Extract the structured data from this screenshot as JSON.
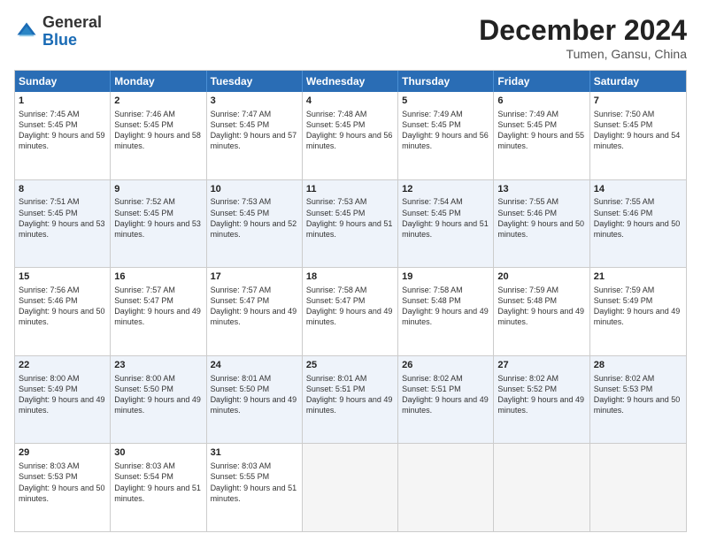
{
  "header": {
    "logo_general": "General",
    "logo_blue": "Blue",
    "month_title": "December 2024",
    "location": "Tumen, Gansu, China"
  },
  "days_of_week": [
    "Sunday",
    "Monday",
    "Tuesday",
    "Wednesday",
    "Thursday",
    "Friday",
    "Saturday"
  ],
  "weeks": [
    [
      {
        "day": "1",
        "sunrise": "Sunrise: 7:45 AM",
        "sunset": "Sunset: 5:45 PM",
        "daylight": "Daylight: 9 hours and 59 minutes."
      },
      {
        "day": "2",
        "sunrise": "Sunrise: 7:46 AM",
        "sunset": "Sunset: 5:45 PM",
        "daylight": "Daylight: 9 hours and 58 minutes."
      },
      {
        "day": "3",
        "sunrise": "Sunrise: 7:47 AM",
        "sunset": "Sunset: 5:45 PM",
        "daylight": "Daylight: 9 hours and 57 minutes."
      },
      {
        "day": "4",
        "sunrise": "Sunrise: 7:48 AM",
        "sunset": "Sunset: 5:45 PM",
        "daylight": "Daylight: 9 hours and 56 minutes."
      },
      {
        "day": "5",
        "sunrise": "Sunrise: 7:49 AM",
        "sunset": "Sunset: 5:45 PM",
        "daylight": "Daylight: 9 hours and 56 minutes."
      },
      {
        "day": "6",
        "sunrise": "Sunrise: 7:49 AM",
        "sunset": "Sunset: 5:45 PM",
        "daylight": "Daylight: 9 hours and 55 minutes."
      },
      {
        "day": "7",
        "sunrise": "Sunrise: 7:50 AM",
        "sunset": "Sunset: 5:45 PM",
        "daylight": "Daylight: 9 hours and 54 minutes."
      }
    ],
    [
      {
        "day": "8",
        "sunrise": "Sunrise: 7:51 AM",
        "sunset": "Sunset: 5:45 PM",
        "daylight": "Daylight: 9 hours and 53 minutes."
      },
      {
        "day": "9",
        "sunrise": "Sunrise: 7:52 AM",
        "sunset": "Sunset: 5:45 PM",
        "daylight": "Daylight: 9 hours and 53 minutes."
      },
      {
        "day": "10",
        "sunrise": "Sunrise: 7:53 AM",
        "sunset": "Sunset: 5:45 PM",
        "daylight": "Daylight: 9 hours and 52 minutes."
      },
      {
        "day": "11",
        "sunrise": "Sunrise: 7:53 AM",
        "sunset": "Sunset: 5:45 PM",
        "daylight": "Daylight: 9 hours and 51 minutes."
      },
      {
        "day": "12",
        "sunrise": "Sunrise: 7:54 AM",
        "sunset": "Sunset: 5:45 PM",
        "daylight": "Daylight: 9 hours and 51 minutes."
      },
      {
        "day": "13",
        "sunrise": "Sunrise: 7:55 AM",
        "sunset": "Sunset: 5:46 PM",
        "daylight": "Daylight: 9 hours and 50 minutes."
      },
      {
        "day": "14",
        "sunrise": "Sunrise: 7:55 AM",
        "sunset": "Sunset: 5:46 PM",
        "daylight": "Daylight: 9 hours and 50 minutes."
      }
    ],
    [
      {
        "day": "15",
        "sunrise": "Sunrise: 7:56 AM",
        "sunset": "Sunset: 5:46 PM",
        "daylight": "Daylight: 9 hours and 50 minutes."
      },
      {
        "day": "16",
        "sunrise": "Sunrise: 7:57 AM",
        "sunset": "Sunset: 5:47 PM",
        "daylight": "Daylight: 9 hours and 49 minutes."
      },
      {
        "day": "17",
        "sunrise": "Sunrise: 7:57 AM",
        "sunset": "Sunset: 5:47 PM",
        "daylight": "Daylight: 9 hours and 49 minutes."
      },
      {
        "day": "18",
        "sunrise": "Sunrise: 7:58 AM",
        "sunset": "Sunset: 5:47 PM",
        "daylight": "Daylight: 9 hours and 49 minutes."
      },
      {
        "day": "19",
        "sunrise": "Sunrise: 7:58 AM",
        "sunset": "Sunset: 5:48 PM",
        "daylight": "Daylight: 9 hours and 49 minutes."
      },
      {
        "day": "20",
        "sunrise": "Sunrise: 7:59 AM",
        "sunset": "Sunset: 5:48 PM",
        "daylight": "Daylight: 9 hours and 49 minutes."
      },
      {
        "day": "21",
        "sunrise": "Sunrise: 7:59 AM",
        "sunset": "Sunset: 5:49 PM",
        "daylight": "Daylight: 9 hours and 49 minutes."
      }
    ],
    [
      {
        "day": "22",
        "sunrise": "Sunrise: 8:00 AM",
        "sunset": "Sunset: 5:49 PM",
        "daylight": "Daylight: 9 hours and 49 minutes."
      },
      {
        "day": "23",
        "sunrise": "Sunrise: 8:00 AM",
        "sunset": "Sunset: 5:50 PM",
        "daylight": "Daylight: 9 hours and 49 minutes."
      },
      {
        "day": "24",
        "sunrise": "Sunrise: 8:01 AM",
        "sunset": "Sunset: 5:50 PM",
        "daylight": "Daylight: 9 hours and 49 minutes."
      },
      {
        "day": "25",
        "sunrise": "Sunrise: 8:01 AM",
        "sunset": "Sunset: 5:51 PM",
        "daylight": "Daylight: 9 hours and 49 minutes."
      },
      {
        "day": "26",
        "sunrise": "Sunrise: 8:02 AM",
        "sunset": "Sunset: 5:51 PM",
        "daylight": "Daylight: 9 hours and 49 minutes."
      },
      {
        "day": "27",
        "sunrise": "Sunrise: 8:02 AM",
        "sunset": "Sunset: 5:52 PM",
        "daylight": "Daylight: 9 hours and 49 minutes."
      },
      {
        "day": "28",
        "sunrise": "Sunrise: 8:02 AM",
        "sunset": "Sunset: 5:53 PM",
        "daylight": "Daylight: 9 hours and 50 minutes."
      }
    ],
    [
      {
        "day": "29",
        "sunrise": "Sunrise: 8:03 AM",
        "sunset": "Sunset: 5:53 PM",
        "daylight": "Daylight: 9 hours and 50 minutes."
      },
      {
        "day": "30",
        "sunrise": "Sunrise: 8:03 AM",
        "sunset": "Sunset: 5:54 PM",
        "daylight": "Daylight: 9 hours and 51 minutes."
      },
      {
        "day": "31",
        "sunrise": "Sunrise: 8:03 AM",
        "sunset": "Sunset: 5:55 PM",
        "daylight": "Daylight: 9 hours and 51 minutes."
      },
      null,
      null,
      null,
      null
    ]
  ]
}
